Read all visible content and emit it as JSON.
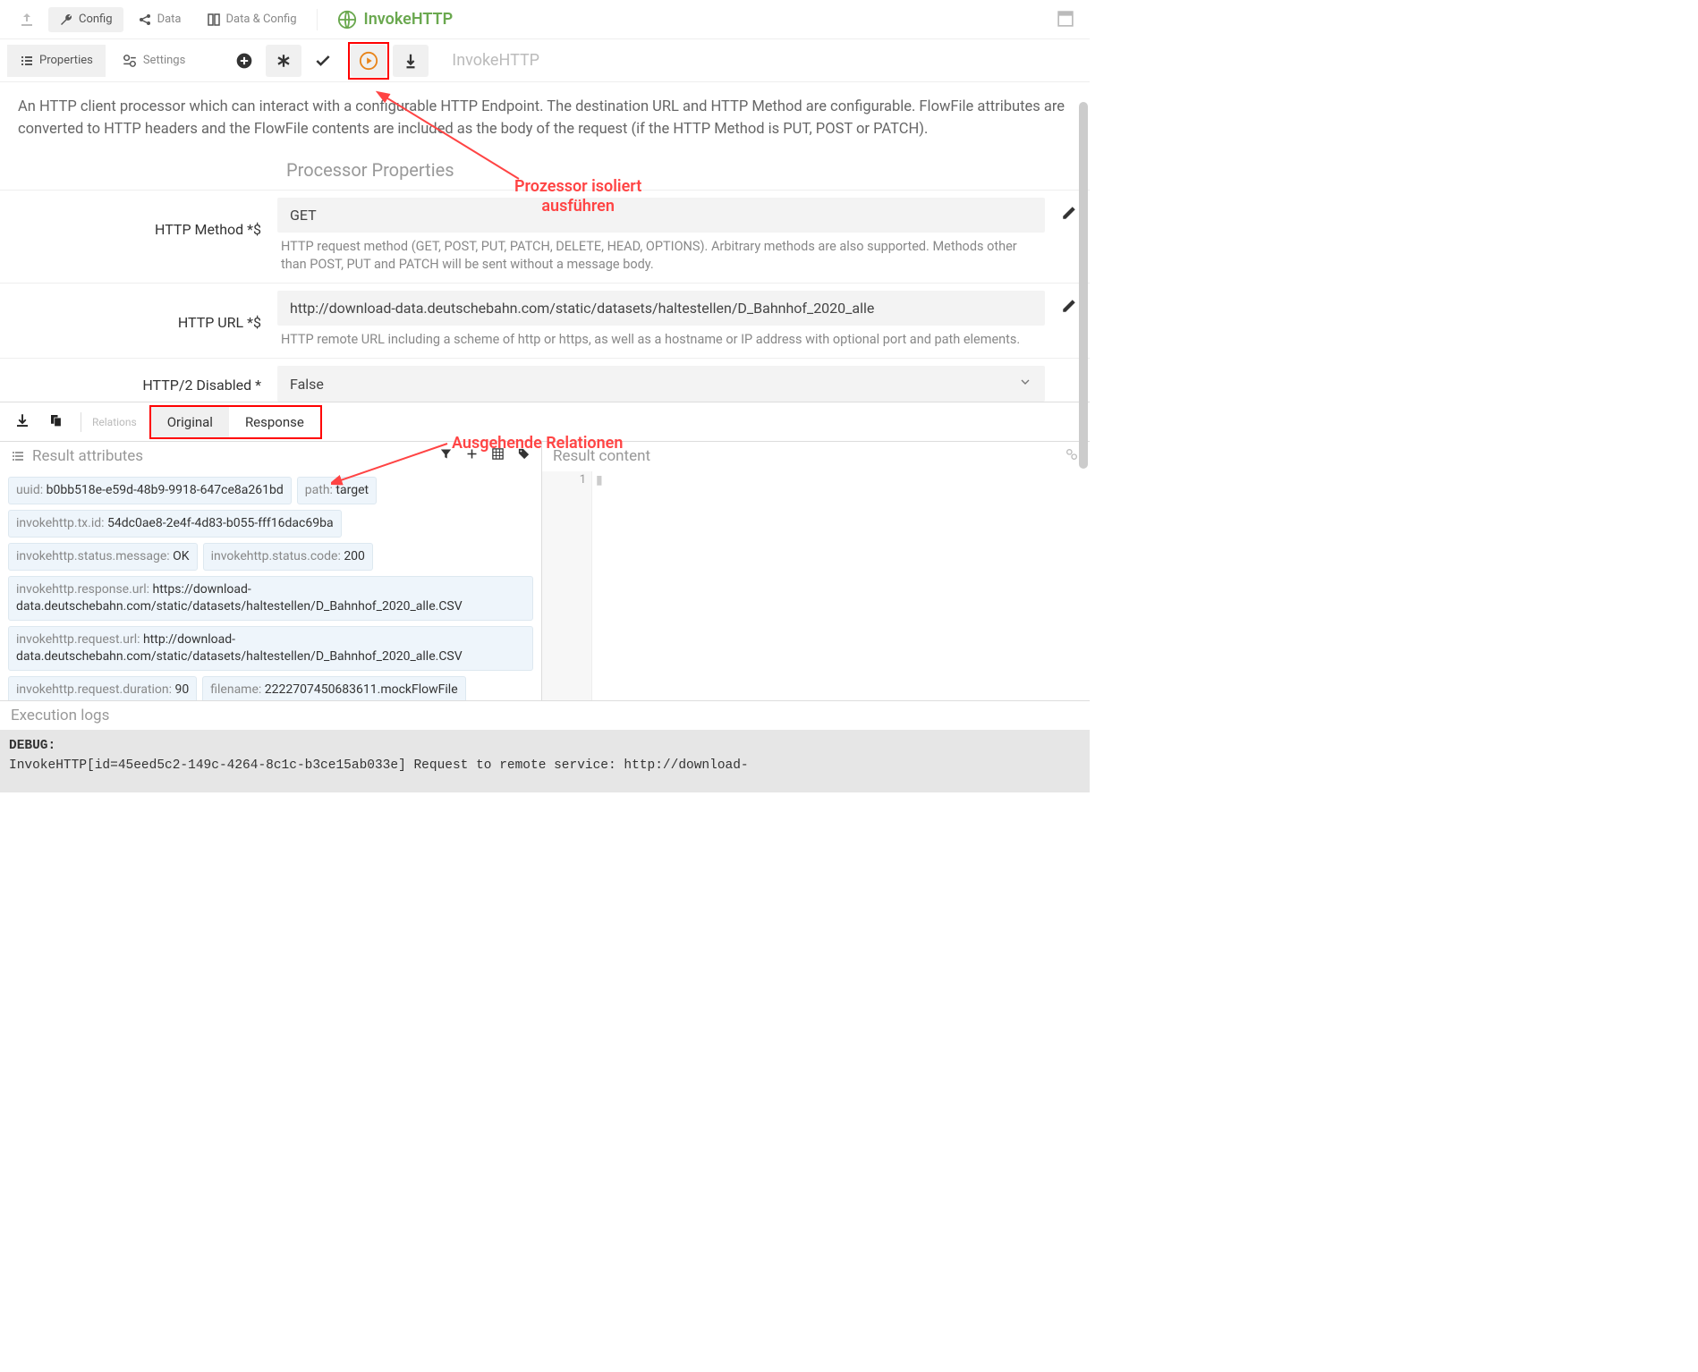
{
  "toolbar": {
    "config": "Config",
    "data": "Data",
    "dataConfig": "Data & Config"
  },
  "processor": {
    "name": "InvokeHTTP",
    "subtitle": "InvokeHTTP",
    "description": "An HTTP client processor which can interact with a configurable HTTP Endpoint. The destination URL and HTTP Method are configurable. FlowFile attributes are converted to HTTP headers and the FlowFile contents are included as the body of the request (if the HTTP Method is PUT, POST or PATCH)."
  },
  "tabs": {
    "properties": "Properties",
    "settings": "Settings"
  },
  "props": {
    "section_title": "Processor Properties",
    "method": {
      "label": "HTTP Method *$",
      "value": "GET",
      "help": "HTTP request method (GET, POST, PUT, PATCH, DELETE, HEAD, OPTIONS). Arbitrary methods are also supported. Methods other than POST, PUT and PATCH will be sent without a message body."
    },
    "url": {
      "label": "HTTP URL *$",
      "value": "http://download-data.deutschebahn.com/static/datasets/haltestellen/D_Bahnhof_2020_alle",
      "help": "HTTP remote URL including a scheme of http or https, as well as a hostname or IP address with optional port and path elements."
    },
    "http2": {
      "label": "HTTP/2 Disabled *",
      "value": "False"
    }
  },
  "relations": {
    "label": "Relations",
    "tabs": [
      "Original",
      "Response"
    ]
  },
  "results": {
    "attrs_title": "Result attributes",
    "content_title": "Result content",
    "line_number": "1",
    "attrs": [
      {
        "k": "uuid",
        "v": "b0bb518e-e59d-48b9-9918-647ce8a261bd"
      },
      {
        "k": "path",
        "v": "target"
      },
      {
        "k": "invokehttp.tx.id",
        "v": "54dc0ae8-2e4f-4d83-b055-fff16dac69ba"
      },
      {
        "k": "invokehttp.status.message",
        "v": "OK"
      },
      {
        "k": "invokehttp.status.code",
        "v": "200"
      },
      {
        "k": "invokehttp.response.url",
        "v": "https://download-data.deutschebahn.com/static/datasets/haltestellen/D_Bahnhof_2020_alle.CSV"
      },
      {
        "k": "invokehttp.request.url",
        "v": "http://download-data.deutschebahn.com/static/datasets/haltestellen/D_Bahnhof_2020_alle.CSV"
      },
      {
        "k": "invokehttp.request.duration",
        "v": "90"
      },
      {
        "k": "filename",
        "v": "2222707450683611.mockFlowFile"
      }
    ]
  },
  "logs": {
    "title": "Execution logs",
    "level": "DEBUG:",
    "line": "InvokeHTTP[id=45eed5c2-149c-4264-8c1c-b3ce15ab033e] Request to remote service: http://download-"
  },
  "annotations": {
    "run": "Prozessor isoliert\nausführen",
    "relations": "Ausgehende Relationen"
  }
}
